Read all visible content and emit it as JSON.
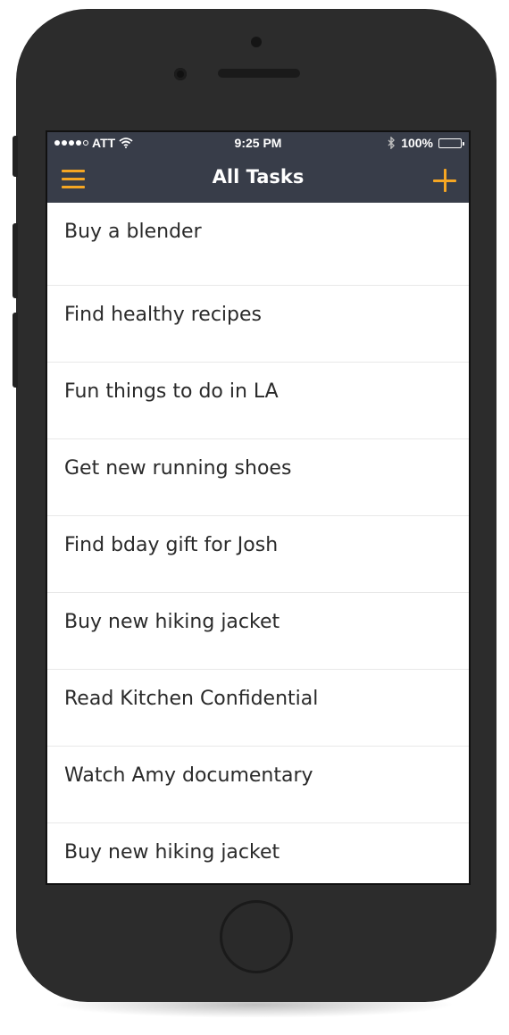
{
  "status_bar": {
    "carrier": "ATT",
    "time": "9:25 PM",
    "battery": "100%"
  },
  "nav": {
    "title": "All Tasks"
  },
  "tasks": [
    "Buy a blender",
    "Find healthy recipes",
    "Fun things to do in LA",
    "Get new running shoes",
    "Find bday gift for Josh",
    "Buy new hiking jacket",
    "Read Kitchen Confidential",
    "Watch Amy documentary",
    "Buy new hiking jacket"
  ],
  "colors": {
    "header_bg": "#383d49",
    "accent": "#f5a623",
    "phone_body": "#2c2c2c"
  },
  "icons": [
    "hamburger-menu-icon",
    "plus-icon",
    "wifi-icon",
    "bluetooth-icon",
    "battery-icon",
    "signal-icon"
  ]
}
